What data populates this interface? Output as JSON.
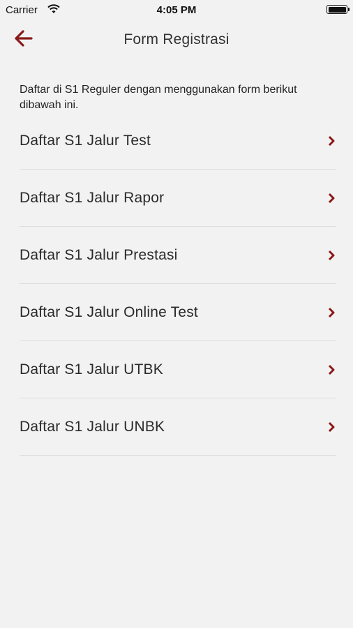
{
  "status_bar": {
    "carrier": "Carrier",
    "time": "4:05 PM"
  },
  "header": {
    "title": "Form Registrasi",
    "back_icon": "arrow-left-icon"
  },
  "intro_text": "Daftar di S1 Reguler dengan menggunakan form berikut dibawah ini.",
  "menu": {
    "items": [
      {
        "label": "Daftar S1 Jalur Test"
      },
      {
        "label": "Daftar S1 Jalur Rapor"
      },
      {
        "label": "Daftar S1 Jalur Prestasi"
      },
      {
        "label": "Daftar S1 Jalur Online Test"
      },
      {
        "label": "Daftar S1 Jalur UTBK"
      },
      {
        "label": "Daftar S1 Jalur UNBK"
      }
    ],
    "chevron_icon": "chevron-right-icon"
  },
  "colors": {
    "accent": "#8b1a1a",
    "background": "#f2f2f2",
    "divider": "#dcdcdc"
  }
}
